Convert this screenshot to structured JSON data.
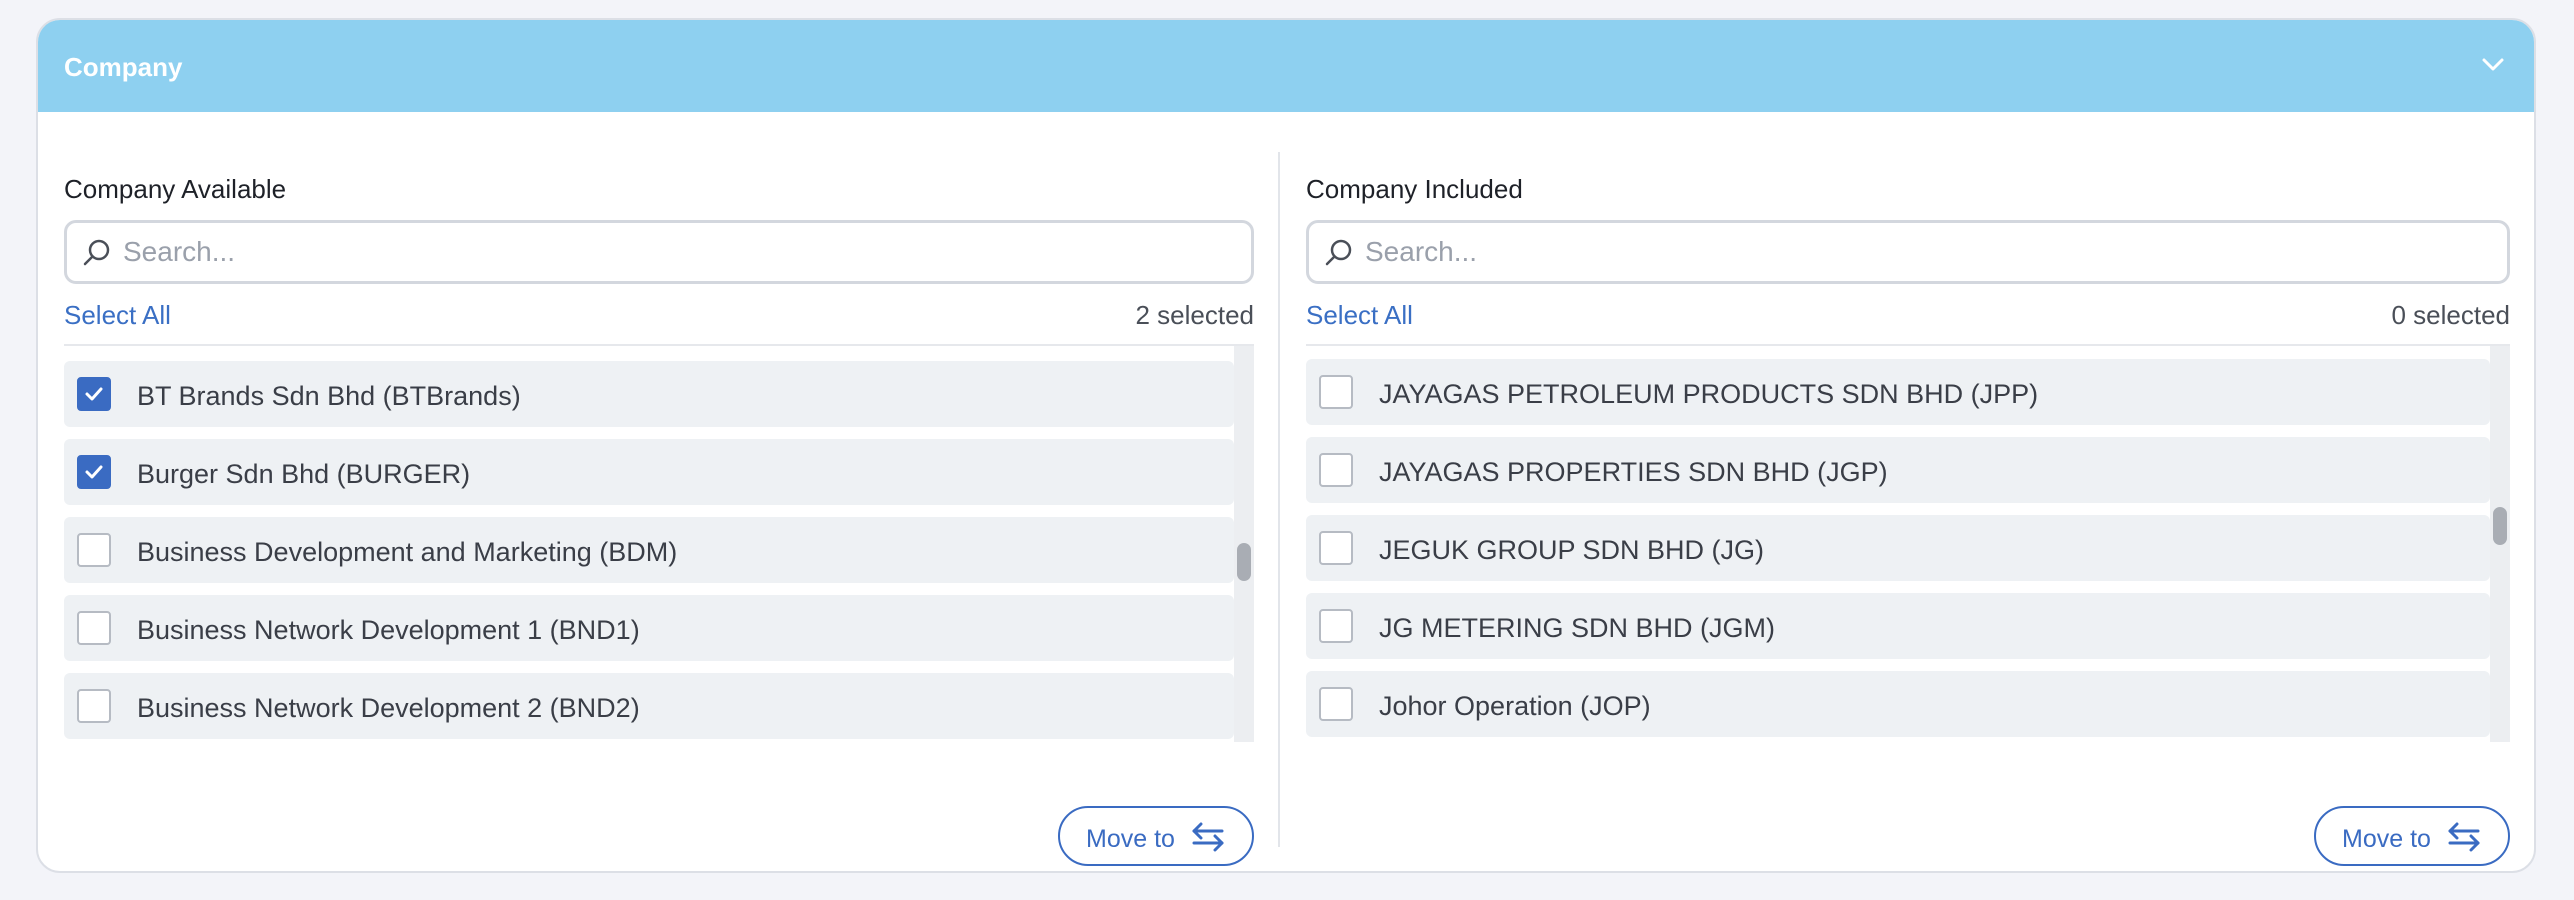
{
  "header": {
    "title": "Company"
  },
  "available": {
    "title": "Company Available",
    "search_placeholder": "Search...",
    "select_all": "Select All",
    "selected_count": "2 selected",
    "scroll_position": 0.55,
    "items": [
      {
        "label": "BT Brands Sdn Bhd (BTBrands)",
        "checked": true
      },
      {
        "label": "Burger Sdn Bhd (BURGER)",
        "checked": true
      },
      {
        "label": "Business Development and Marketing (BDM)",
        "checked": false
      },
      {
        "label": "Business Network Development 1 (BND1)",
        "checked": false
      },
      {
        "label": "Business Network Development 2 (BND2)",
        "checked": false
      }
    ],
    "move_label": "Move to"
  },
  "included": {
    "title": "Company Included",
    "search_placeholder": "Search...",
    "select_all": "Select All",
    "selected_count": "0 selected",
    "scroll_position": 0.45,
    "items": [
      {
        "label": "JAYAGAS PETROLEUM PRODUCTS SDN BHD (JPP)",
        "checked": false
      },
      {
        "label": "JAYAGAS PROPERTIES SDN BHD (JGP)",
        "checked": false
      },
      {
        "label": "JEGUK GROUP SDN BHD (JG)",
        "checked": false
      },
      {
        "label": "JG METERING SDN BHD (JGM)",
        "checked": false
      },
      {
        "label": "Johor Operation (JOP)",
        "checked": false
      }
    ],
    "move_label": "Move to"
  },
  "colors": {
    "header": "#8ed0f0",
    "accent": "#3a6bc2",
    "row": "#eef1f4"
  },
  "icons": {
    "header": "chevron-down-icon",
    "search": "search-icon",
    "move": "swap-arrows-icon",
    "check": "check-icon"
  }
}
